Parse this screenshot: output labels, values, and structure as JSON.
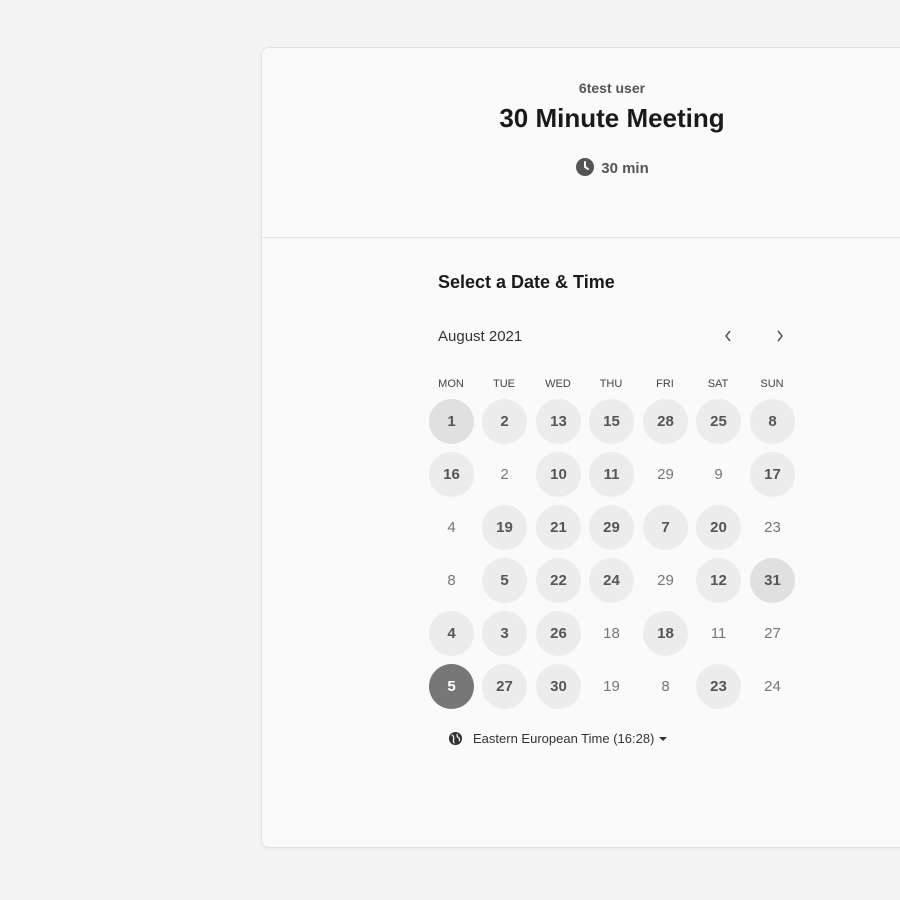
{
  "event": {
    "host": "6test user",
    "title": "30 Minute Meeting",
    "duration": "30 min"
  },
  "calendar": {
    "section_title": "Select a Date & Time",
    "month_label": "August 2021",
    "weekdays": [
      "MON",
      "TUE",
      "WED",
      "THU",
      "FRI",
      "SAT",
      "SUN"
    ],
    "rows": [
      [
        {
          "d": "1",
          "s": "avail"
        },
        {
          "d": "2",
          "s": "avail"
        },
        {
          "d": "13",
          "s": "avail"
        },
        {
          "d": "15",
          "s": "avail"
        },
        {
          "d": "28",
          "s": "avail"
        },
        {
          "d": "25",
          "s": "avail"
        },
        {
          "d": "8",
          "s": "avail"
        }
      ],
      [
        {
          "d": "16",
          "s": "avail"
        },
        {
          "d": "2",
          "s": "plain"
        },
        {
          "d": "10",
          "s": "avail"
        },
        {
          "d": "11",
          "s": "avail"
        },
        {
          "d": "29",
          "s": "plain"
        },
        {
          "d": "9",
          "s": "plain"
        },
        {
          "d": "17",
          "s": "avail"
        }
      ],
      [
        {
          "d": "4",
          "s": "plain"
        },
        {
          "d": "19",
          "s": "avail"
        },
        {
          "d": "21",
          "s": "avail"
        },
        {
          "d": "29",
          "s": "avail"
        },
        {
          "d": "7",
          "s": "avail"
        },
        {
          "d": "20",
          "s": "avail"
        },
        {
          "d": "23",
          "s": "plain"
        }
      ],
      [
        {
          "d": "8",
          "s": "plain"
        },
        {
          "d": "5",
          "s": "avail"
        },
        {
          "d": "22",
          "s": "avail"
        },
        {
          "d": "24",
          "s": "avail"
        },
        {
          "d": "29",
          "s": "plain"
        },
        {
          "d": "12",
          "s": "avail"
        },
        {
          "d": "31",
          "s": "avail"
        }
      ],
      [
        {
          "d": "4",
          "s": "avail"
        },
        {
          "d": "3",
          "s": "avail"
        },
        {
          "d": "26",
          "s": "avail"
        },
        {
          "d": "18",
          "s": "plain"
        },
        {
          "d": "18",
          "s": "avail"
        },
        {
          "d": "11",
          "s": "plain"
        },
        {
          "d": "27",
          "s": "plain"
        }
      ],
      [
        {
          "d": "5",
          "s": "selected"
        },
        {
          "d": "27",
          "s": "avail"
        },
        {
          "d": "30",
          "s": "avail"
        },
        {
          "d": "19",
          "s": "plain"
        },
        {
          "d": "8",
          "s": "plain"
        },
        {
          "d": "23",
          "s": "avail"
        },
        {
          "d": "24",
          "s": "plain"
        }
      ]
    ]
  },
  "timezone": {
    "label": "Eastern European Time (16:28)"
  },
  "icons": {
    "duration": "clock-icon",
    "prev": "chevron-left-icon",
    "next": "chevron-right-icon",
    "timezone": "globe-icon"
  },
  "colors": {
    "available_bg": "#ececec",
    "selected_bg": "#777777"
  }
}
